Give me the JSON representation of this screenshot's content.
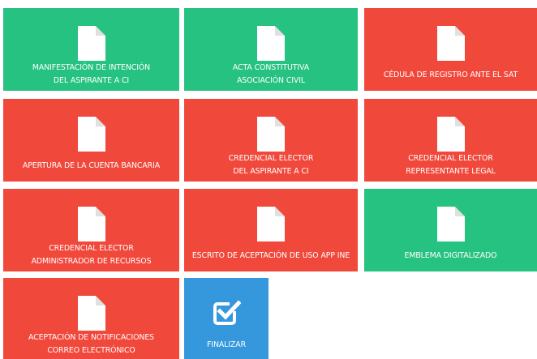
{
  "colors": {
    "complete": "#26c281",
    "pending": "#f1483c",
    "action": "#3598dc"
  },
  "tiles": [
    {
      "status": "complete",
      "icon": "document-icon",
      "line1": "MANIFESTACIÓN DE INTENCIÓN",
      "line2": "DEL ASPIRANTE A CI"
    },
    {
      "status": "complete",
      "icon": "document-icon",
      "line1": "ACTA CONSTITUTIVA",
      "line2": "ASOCIACIÓN CIVIL"
    },
    {
      "status": "pending",
      "icon": "document-icon",
      "line1": "CÉDULA DE REGISTRO ANTE EL SAT",
      "line2": ""
    },
    {
      "status": "pending",
      "icon": "document-icon",
      "line1": "APERTURA DE LA CUENTA BANCARIA",
      "line2": ""
    },
    {
      "status": "pending",
      "icon": "document-icon",
      "line1": "CREDENCIAL ELECTOR",
      "line2": "DEL ASPIRANTE A CI"
    },
    {
      "status": "pending",
      "icon": "document-icon",
      "line1": "CREDENCIAL ELECTOR",
      "line2": "REPRESENTANTE LEGAL"
    },
    {
      "status": "pending",
      "icon": "document-icon",
      "line1": "CREDENCIAL ELECTOR",
      "line2": "ADMINISTRADOR DE RECURSOS"
    },
    {
      "status": "pending",
      "icon": "document-icon",
      "line1": "ESCRITO DE ACEPTACIÓN DE USO APP INE",
      "line2": ""
    },
    {
      "status": "complete",
      "icon": "document-icon",
      "line1": "EMBLEMA DIGITALIZADO",
      "line2": ""
    },
    {
      "status": "pending",
      "icon": "document-icon",
      "line1": "ACEPTACIÓN DE NOTIFICACIONES",
      "line2": "CORREO ELECTRÓNICO"
    }
  ],
  "finish": {
    "icon": "checkbox-check-icon",
    "label": "FINALIZAR"
  }
}
